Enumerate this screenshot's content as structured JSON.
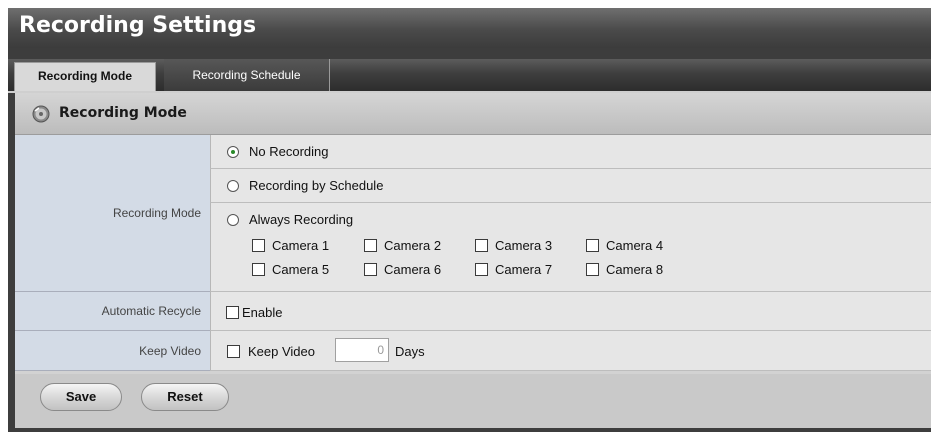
{
  "page": {
    "title": "Recording Settings"
  },
  "tabs": [
    {
      "label": "Recording Mode",
      "active": true
    },
    {
      "label": "Recording Schedule",
      "active": false
    }
  ],
  "section": {
    "title": "Recording Mode",
    "icon": "disc-icon"
  },
  "form": {
    "recording_mode": {
      "label": "Recording Mode",
      "options": [
        {
          "label": "No Recording",
          "selected": true
        },
        {
          "label": "Recording by Schedule",
          "selected": false
        },
        {
          "label": "Always Recording",
          "selected": false
        }
      ],
      "cameras": [
        {
          "label": "Camera 1",
          "checked": false
        },
        {
          "label": "Camera 2",
          "checked": false
        },
        {
          "label": "Camera 3",
          "checked": false
        },
        {
          "label": "Camera 4",
          "checked": false
        },
        {
          "label": "Camera 5",
          "checked": false
        },
        {
          "label": "Camera 6",
          "checked": false
        },
        {
          "label": "Camera 7",
          "checked": false
        },
        {
          "label": "Camera 8",
          "checked": false
        }
      ]
    },
    "automatic_recycle": {
      "label": "Automatic Recycle",
      "checkbox_label": "Enable",
      "checked": false
    },
    "keep_video": {
      "label": "Keep Video",
      "checkbox_label": "Keep Video",
      "checked": false,
      "days_value": "0",
      "days_unit": "Days"
    }
  },
  "buttons": {
    "save": "Save",
    "reset": "Reset"
  },
  "colors": {
    "header_bg": "#3d3d3d",
    "label_bg": "#d3dbe6",
    "value_bg": "#e6e6e6",
    "radio_selected": "#2a8a2a"
  }
}
